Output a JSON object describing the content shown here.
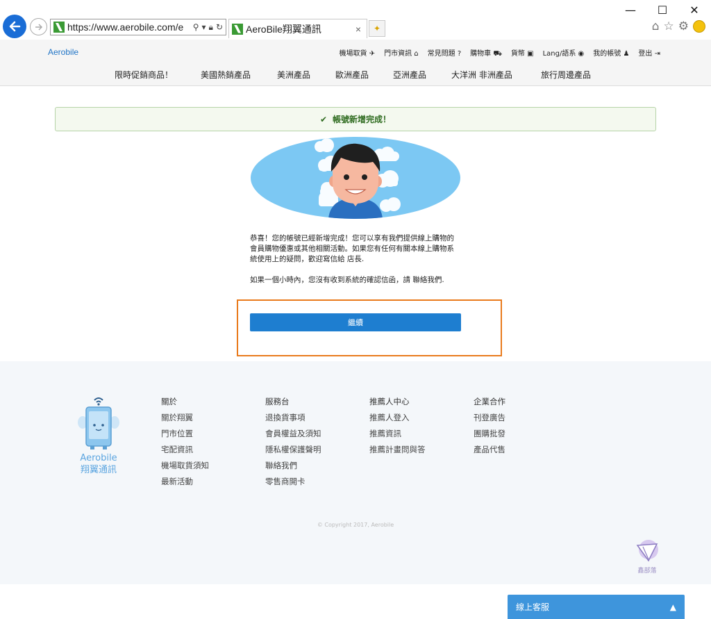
{
  "browser": {
    "url": "https://www.aerobile.com/e",
    "tab_title": "AeroBile翔翼通訊",
    "tab_close": "×",
    "minimize": "—",
    "maximize": "☐",
    "close": "✕"
  },
  "header": {
    "brand": "Aerobile",
    "topnav": [
      {
        "label": "機場取貨",
        "icon": "plane-icon",
        "glyph": "✈"
      },
      {
        "label": "門市資訊",
        "icon": "home-icon",
        "glyph": "⌂"
      },
      {
        "label": "常見問題",
        "icon": "question-icon",
        "glyph": "?"
      },
      {
        "label": "購物車",
        "icon": "cart-icon",
        "glyph": "⛟"
      },
      {
        "label": "貨幣",
        "icon": "money-icon",
        "glyph": "▣"
      },
      {
        "label": "Lang/語系",
        "icon": "globe-icon",
        "glyph": "◉"
      },
      {
        "label": "我的帳號",
        "icon": "user-icon",
        "glyph": "♟"
      },
      {
        "label": "登出",
        "icon": "logout-icon",
        "glyph": "⇥"
      }
    ],
    "mainnav": [
      "限時促銷商品！",
      "美國熱銷產品",
      "美洲產品",
      "歐洲產品",
      "亞洲產品",
      "大洋洲 非洲產品",
      "旅行周邊產品"
    ]
  },
  "main": {
    "alert_text": "帳號新增完成！",
    "message_1": "恭喜！您的帳號已經新增完成！您可以享有我們提供線上購物的會員購物優惠或其他相關活動。如果您有任何有關本線上購物系統使用上的疑問，歡迎寫信給 店長.",
    "message_2": "如果一個小時內，您沒有收到系統的確認信函，請 聯絡我們.",
    "continue_label": "繼續"
  },
  "footer": {
    "logo_line1": "Aerobile",
    "logo_line2": "翔翼通訊",
    "columns": [
      {
        "heading": "關於",
        "items": [
          "關於翔翼",
          "門市位置",
          "宅配資訊",
          "機場取貨須知",
          "最新活動"
        ]
      },
      {
        "heading": "服務台",
        "items": [
          "退換貨事項",
          "會員權益及須知",
          "隱私權保護聲明",
          "聯絡我們",
          "零售商開卡"
        ]
      },
      {
        "heading": "推薦人中心",
        "items": [
          "推薦人登入",
          "推薦資訊",
          "推薦計畫問與答"
        ]
      },
      {
        "heading": "企業合作",
        "items": [
          "刊登廣告",
          "團購批發",
          "產品代售"
        ]
      }
    ],
    "copyright": "© Copyright 2017, Aerobile",
    "watermark": "鑫部落"
  },
  "chat": {
    "label": "線上客服",
    "chevron": "▲"
  },
  "colors": {
    "accent": "#1e7ed0",
    "focus_outline": "#e97a1c",
    "success": "#2e6b1f"
  }
}
